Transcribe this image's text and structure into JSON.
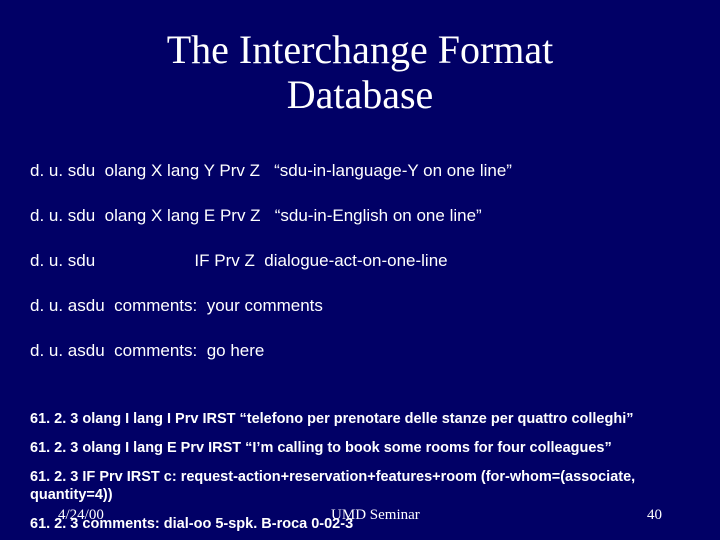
{
  "title_line1": "The Interchange Format",
  "title_line2": "Database",
  "schema": {
    "r1": "d. u. sdu  olang X lang Y Prv Z   “sdu-in-language-Y on one line”",
    "r2": "d. u. sdu  olang X lang E Prv Z   “sdu-in-English on one line”",
    "r3": "d. u. sdu                     IF Prv Z  dialogue-act-on-one-line",
    "r4": "d. u. asdu  comments:  your comments",
    "r5": "d. u. asdu  comments:  go here"
  },
  "examples": {
    "e1": "61. 2. 3 olang I lang I Prv IRST “telefono per prenotare delle stanze per quattro colleghi”",
    "e2": "61. 2. 3 olang I lang E Prv IRST “I’m calling to book some rooms for four colleagues”",
    "e3": "61. 2. 3                   IF Prv IRST c: request-action+reservation+features+room  (for-whom=(associate, quantity=4))",
    "e4": "61. 2. 3  comments: dial-oo 5-spk. B-roca 0-02-3"
  },
  "footer": {
    "date": "4/24/00",
    "venue": "UMD Seminar",
    "page": "40"
  }
}
